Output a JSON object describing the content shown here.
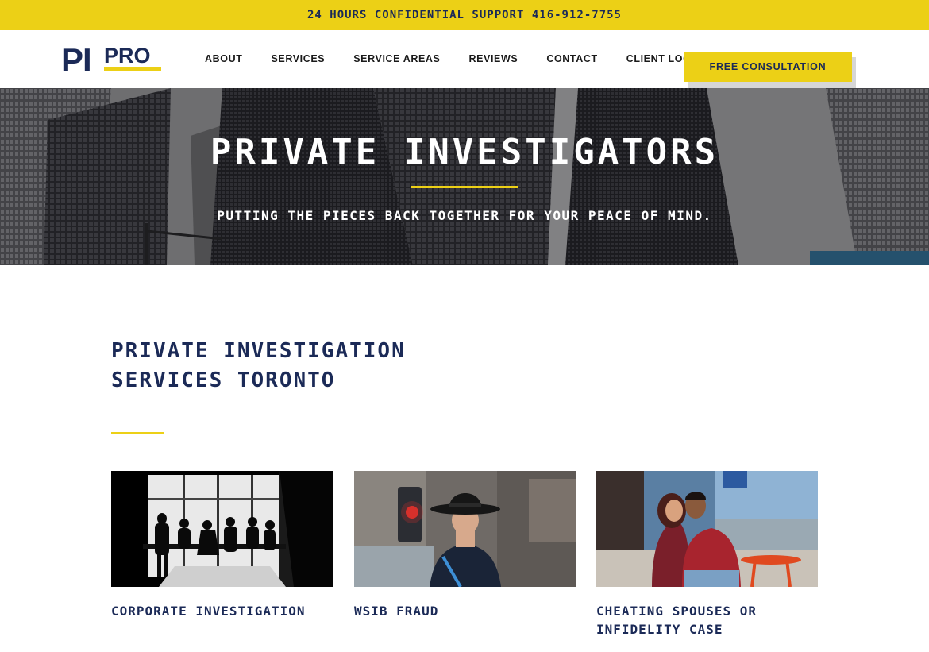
{
  "topbar": {
    "text": "24 HOURS CONFIDENTIAL SUPPORT 416-912-7755"
  },
  "logo": {
    "left": "PI",
    "right": "PRO"
  },
  "nav": {
    "items": [
      "ABOUT",
      "SERVICES",
      "SERVICE AREAS",
      "REVIEWS",
      "CONTACT",
      "CLIENT LOGIN"
    ],
    "cta": "FREE CONSULTATION"
  },
  "hero": {
    "title": "PRIVATE INVESTIGATORS",
    "subtitle": "PUTTING THE PIECES BACK TOGETHER FOR YOUR PEACE OF MIND."
  },
  "section": {
    "title_line1": "PRIVATE INVESTIGATION",
    "title_line2": "SERVICES TORONTO"
  },
  "cards": [
    {
      "caption": "CORPORATE INVESTIGATION"
    },
    {
      "caption": "WSIB FRAUD"
    },
    {
      "caption_line1": "CHEATING SPOUSES OR",
      "caption_line2": "INFIDELITY CASE"
    }
  ],
  "colors": {
    "accent": "#ecd016",
    "navy": "#1b2a57",
    "text": "#1a1a1a"
  }
}
